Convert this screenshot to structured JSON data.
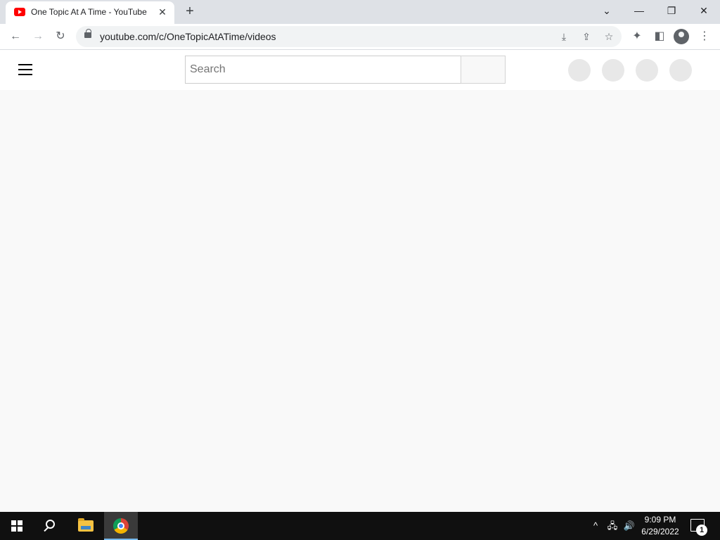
{
  "browser": {
    "tab": {
      "title": "One Topic At A Time - YouTube",
      "favicon": "youtube-icon",
      "close_glyph": "✕"
    },
    "new_tab_glyph": "+",
    "window_controls": {
      "tab_search_glyph": "⌄",
      "minimize_glyph": "—",
      "restore_glyph": "❐",
      "close_glyph": "✕"
    },
    "toolbar": {
      "back_glyph": "←",
      "forward_glyph": "→",
      "reload_glyph": "↻",
      "url": "youtube.com/c/OneTopicAtATime/videos",
      "install_glyph": "⤓",
      "share_glyph": "⇪",
      "bookmark_glyph": "☆",
      "extensions_glyph": "✦",
      "side_panel_glyph": "◧",
      "menu_glyph": "⋮"
    }
  },
  "youtube": {
    "search": {
      "placeholder": "Search",
      "value": ""
    }
  },
  "taskbar": {
    "tray": {
      "chevron_glyph": "^",
      "network_glyph": "🖧",
      "volume_glyph": "🔊"
    },
    "clock": {
      "time": "9:09 PM",
      "date": "6/29/2022"
    },
    "notifications_count": "1"
  },
  "colors": {
    "youtube_red": "#ff0000",
    "page_background": "#f9f9f9",
    "taskbar": "#101010",
    "tab_strip": "#dee1e6"
  }
}
